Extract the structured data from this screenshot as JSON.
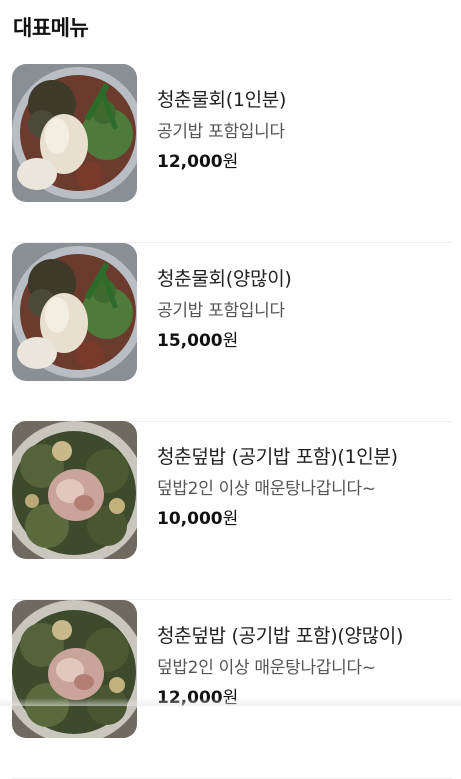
{
  "section": {
    "title": "대표메뉴"
  },
  "menu_items": [
    {
      "name": "청춘물회(1인분)",
      "description": "공기밥 포함입니다",
      "price": "12,000",
      "currency": "원",
      "image_icon": "mulhoe-photo"
    },
    {
      "name": "청춘물회(양많이)",
      "description": "공기밥 포함입니다",
      "price": "15,000",
      "currency": "원",
      "image_icon": "mulhoe-photo"
    },
    {
      "name": "청춘덮밥 (공기밥 포함)(1인분)",
      "description": "덮밥2인 이상 매운탕나갑니다~",
      "price": "10,000",
      "currency": "원",
      "image_icon": "deopbap-photo"
    },
    {
      "name": "청춘덮밥 (공기밥 포함)(양많이)",
      "description": "덮밥2인 이상 매운탕나갑니다~",
      "price": "12,000",
      "currency": "원",
      "image_icon": "deopbap-photo"
    }
  ]
}
